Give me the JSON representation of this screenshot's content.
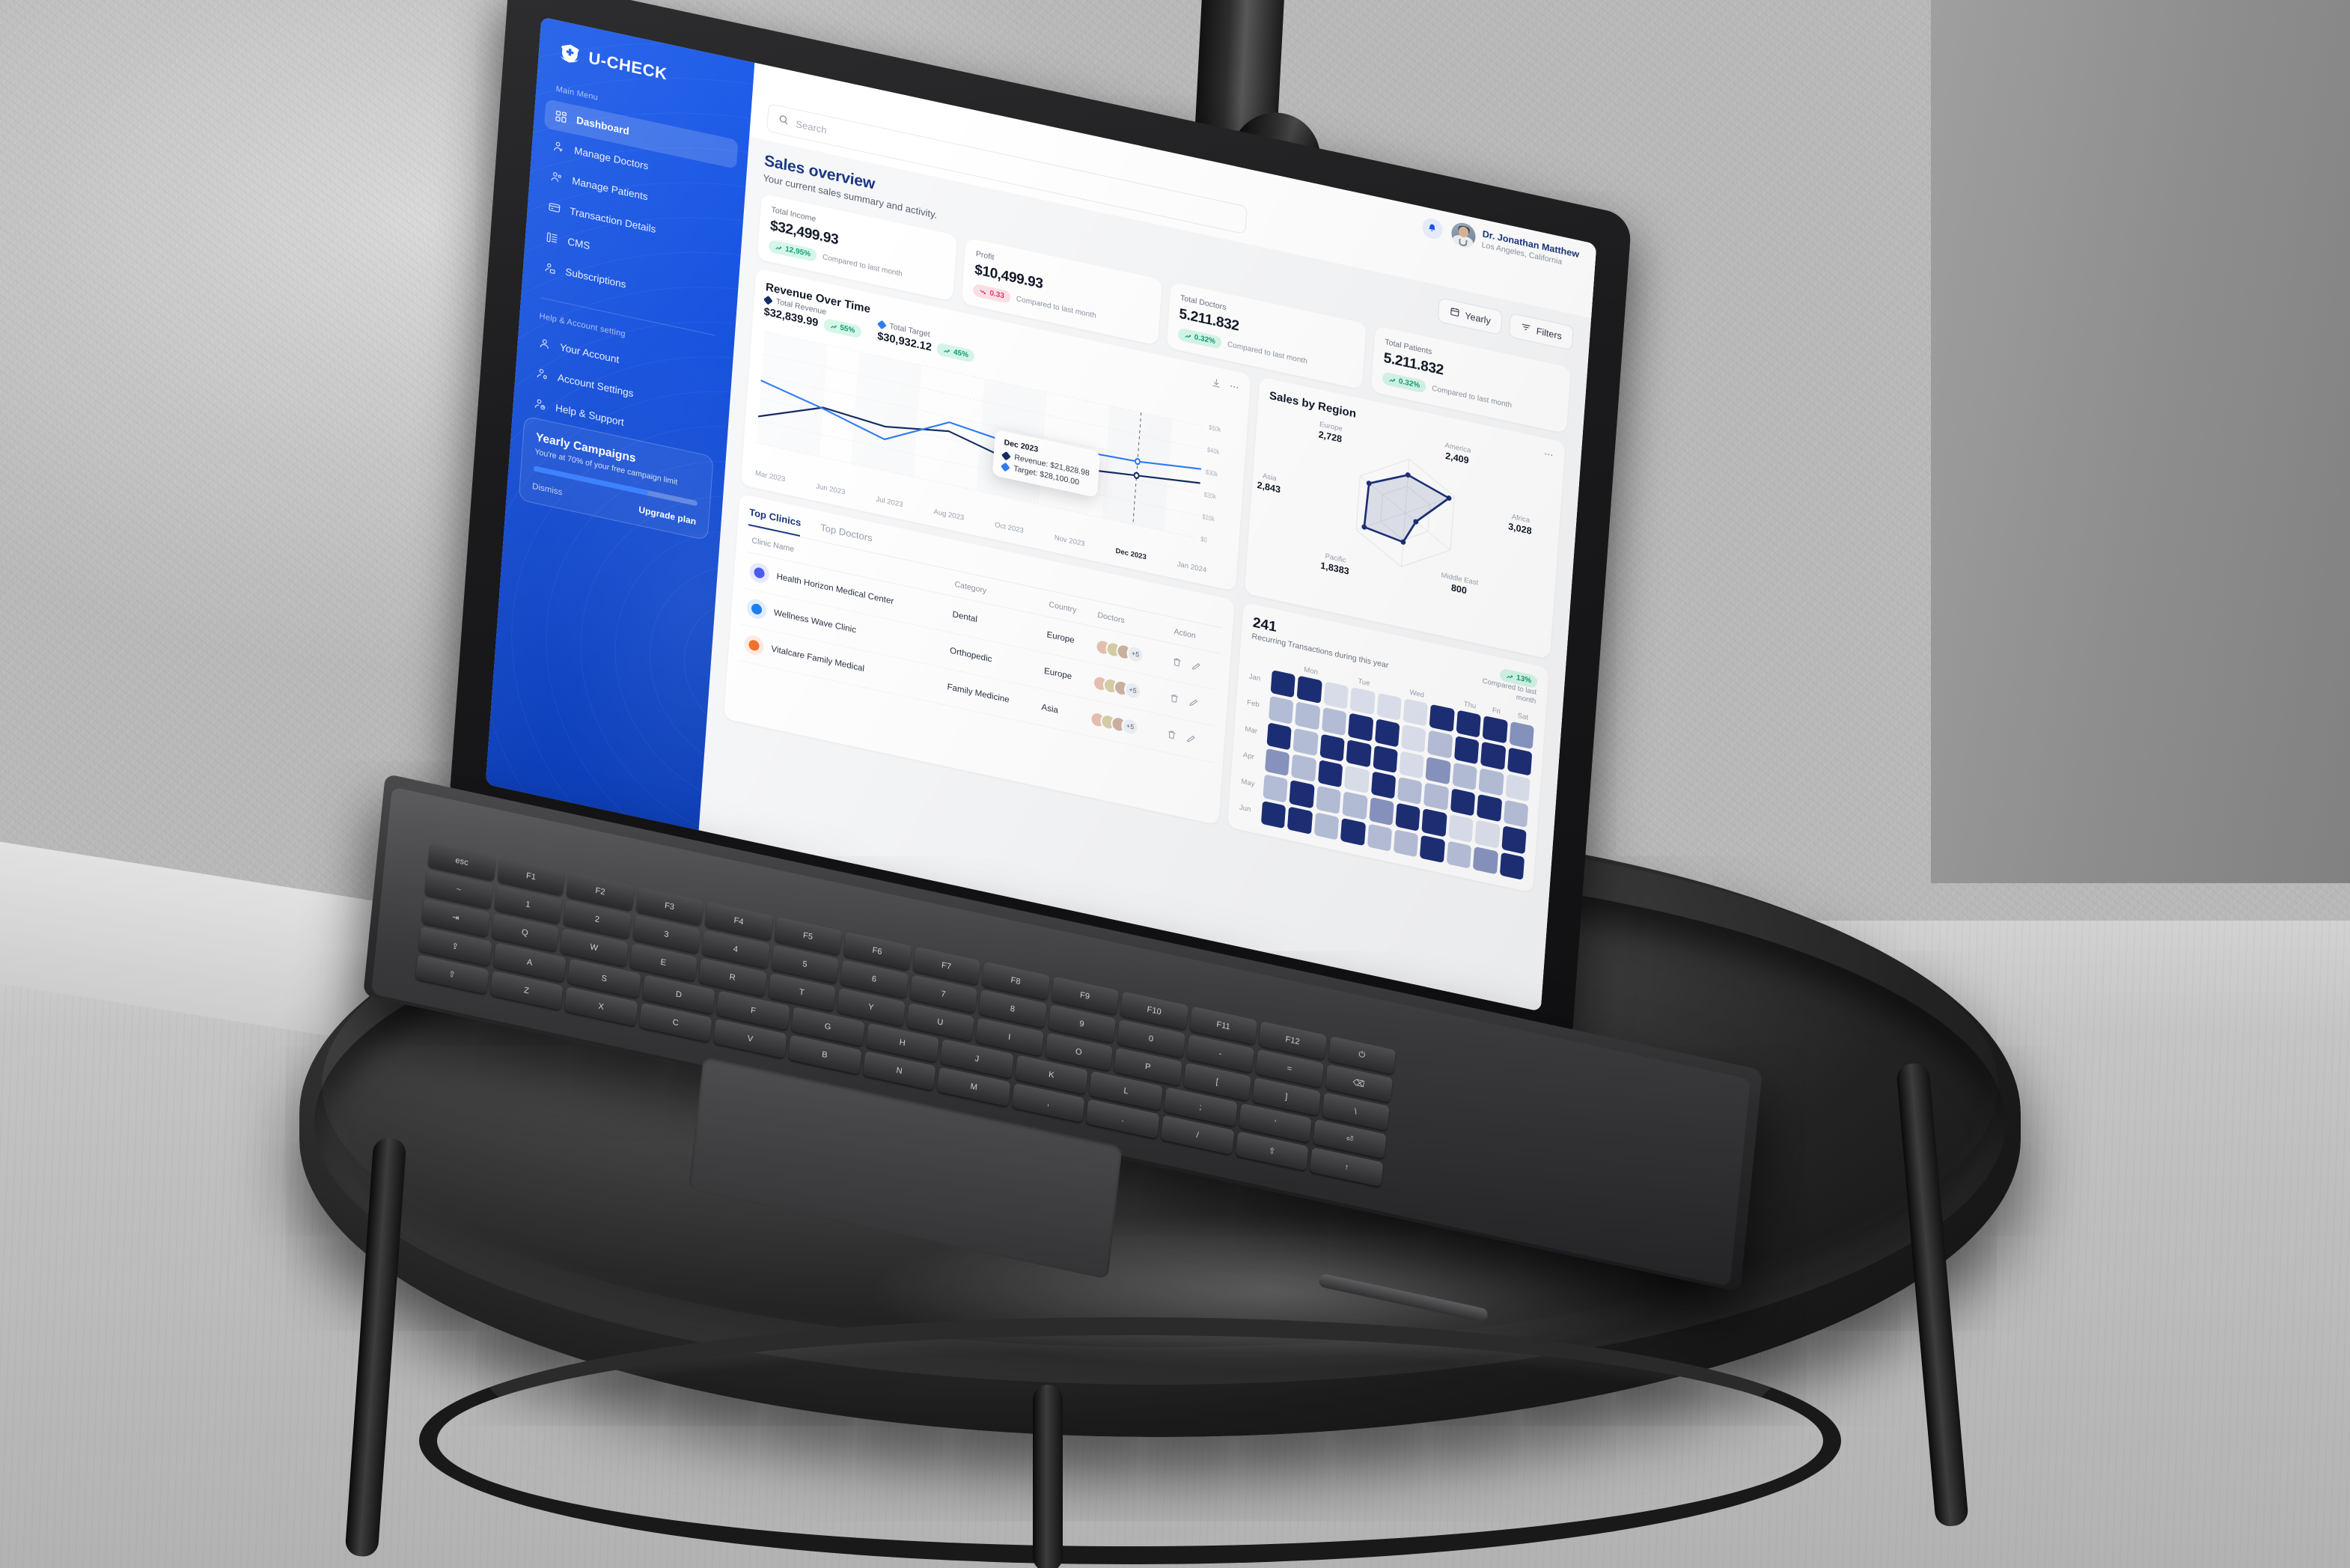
{
  "brand": {
    "name": "U-CHECK",
    "logo_icon": "shield-medical-icon"
  },
  "sidebar": {
    "main_label": "Main Menu",
    "items": [
      {
        "label": "Dashboard",
        "icon": "grid-icon",
        "active": true
      },
      {
        "label": "Manage Doctors",
        "icon": "user-doctor-icon",
        "active": false
      },
      {
        "label": "Manage Patients",
        "icon": "user-group-icon",
        "active": false
      },
      {
        "label": "Transaction Details",
        "icon": "card-icon",
        "active": false
      },
      {
        "label": "CMS",
        "icon": "list-icon",
        "active": false
      },
      {
        "label": "Subscriptions",
        "icon": "user-card-icon",
        "active": false
      }
    ],
    "help_label": "Help & Account setting",
    "help_items": [
      {
        "label": "Your Account",
        "icon": "user-icon"
      },
      {
        "label": "Account Settings",
        "icon": "user-gear-icon"
      },
      {
        "label": "Help & Support",
        "icon": "user-help-icon"
      }
    ],
    "promo": {
      "title": "Yearly Campaigns",
      "subtitle": "You're at 70% of your free campaign limit",
      "progress": 70,
      "dismiss_label": "Dismiss",
      "upgrade_label": "Upgrade plan"
    }
  },
  "topbar": {
    "notification_icon": "bell-icon",
    "user_name": "Dr. Jonathan Matthew",
    "user_location": "Los Angeles, California",
    "search_placeholder": "Search",
    "search_value": "",
    "search_icon": "search-icon"
  },
  "page": {
    "title": "Sales overview",
    "subtitle": "Your current sales summary and activity.",
    "actions": [
      {
        "label": "Yearly",
        "icon": "calendar-icon"
      },
      {
        "label": "Filters",
        "icon": "filter-icon"
      }
    ]
  },
  "stats": [
    {
      "label": "Total Income",
      "value": "$32,499.93",
      "delta": "12,95%",
      "dir": "up",
      "compare": "Compared to last month"
    },
    {
      "label": "Profit",
      "value": "$10,499.93",
      "delta": "0.33",
      "dir": "down",
      "compare": "Compared to last month"
    },
    {
      "label": "Total Doctors",
      "value": "5.211.832",
      "delta": "0.32%",
      "dir": "up",
      "compare": "Compared to last month"
    },
    {
      "label": "Total Patients",
      "value": "5.211.832",
      "delta": "0.32%",
      "dir": "up",
      "compare": "Compared to last month"
    }
  ],
  "revenue_card": {
    "title": "Revenue Over Time",
    "download_icon": "download-icon",
    "more_icon": "more-horizontal-icon",
    "legend": [
      {
        "name": "Total Revenue",
        "value": "$32,839.99",
        "delta": "55%",
        "color": "#132a63"
      },
      {
        "name": "Total Target",
        "value": "$30,932.12",
        "delta": "45%",
        "color": "#2f7bf6"
      }
    ],
    "tooltip": {
      "title": "Dec 2023",
      "rows": [
        {
          "label": "Revenue: $21,828.98",
          "color": "#132a63"
        },
        {
          "label": "Target: $28,100.00",
          "color": "#2f7bf6"
        }
      ]
    }
  },
  "region_card": {
    "title": "Sales by Region",
    "more_icon": "more-horizontal-icon"
  },
  "heatmap_card": {
    "value": "241",
    "subtitle": "Recurring Transactions during this year",
    "delta": "13%",
    "dir": "up",
    "compare": "Compared to last month"
  },
  "table": {
    "tabs": [
      {
        "label": "Top Clinics",
        "active": true
      },
      {
        "label": "Top Doctors",
        "active": false
      }
    ],
    "columns": [
      "Clinic Name",
      "Category",
      "Country",
      "Doctors",
      "Action"
    ],
    "rows": [
      {
        "name": "Health Horizon Medical Center",
        "category": "Dental",
        "country": "Europe",
        "doctors_more": "+5",
        "logo": "#4a5cf0"
      },
      {
        "name": "Wellness Wave Clinic",
        "category": "Orthopedic",
        "country": "Europe",
        "doctors_more": "+5",
        "logo": "#1e7ef0"
      },
      {
        "name": "Vitalcare Family Medical",
        "category": "Family Medicine",
        "country": "Asia",
        "doctors_more": "+5",
        "logo": "#f2722b"
      }
    ],
    "delete_icon": "trash-icon",
    "edit_icon": "pencil-icon"
  },
  "colors": {
    "brand_blue": "#1556e8",
    "deep_navy": "#17347f",
    "revenue_line": "#132a63",
    "target_line": "#2f7bf6",
    "up_green": "#0e9f6e",
    "down_red": "#e0366b"
  },
  "chart_data": [
    {
      "type": "line",
      "title": "Revenue Over Time",
      "xlabel": "",
      "ylabel": "",
      "ylim": [
        0,
        50000
      ],
      "yticks": [
        "$0",
        "$10k",
        "$20k",
        "$30k",
        "$40k",
        "$50k"
      ],
      "x": [
        "Mar 2023",
        "Jun 2023",
        "Jul 2023",
        "Aug 2023",
        "Oct 2023",
        "Nov 2023",
        "Dec 2023",
        "Jan 2024"
      ],
      "grid": true,
      "legend": "top-left",
      "highlight_x": "Dec 2023",
      "series": [
        {
          "name": "Total Revenue",
          "color": "#132a63",
          "values": [
            12000,
            22000,
            19500,
            23500,
            16500,
            19200,
            21829,
            24500
          ]
        },
        {
          "name": "Total Target",
          "color": "#2f7bf6",
          "values": [
            28000,
            21500,
            13800,
            27500,
            24000,
            27200,
            28100,
            30800
          ]
        }
      ]
    },
    {
      "type": "radar",
      "title": "Sales by Region",
      "categories": [
        "America",
        "Africa",
        "Middle East",
        "Pacific",
        "Asia",
        "Europe"
      ],
      "values": [
        2409,
        3028,
        800,
        18383,
        2843,
        2728
      ],
      "value_labels": [
        "2,409",
        "3,028",
        "800",
        "1,8383",
        "2,843",
        "2,728"
      ],
      "grid": true,
      "legend": "none"
    },
    {
      "type": "heatmap",
      "title": "Recurring Transactions during this year",
      "total": 241,
      "xlabel": "",
      "ylabel": "",
      "columns": [
        "",
        "Mon",
        "",
        "Tue",
        "",
        "Wed",
        "",
        "Thu",
        "Fri",
        "Sat"
      ],
      "rows": [
        "Jan",
        "Feb",
        "Mar",
        "Apr",
        "May",
        "Jun"
      ],
      "values": [
        [
          4,
          4,
          1,
          1,
          1,
          1,
          4,
          4,
          4,
          3
        ],
        [
          2,
          2,
          2,
          4,
          4,
          1,
          2,
          4,
          4,
          4
        ],
        [
          4,
          2,
          4,
          4,
          4,
          1,
          3,
          2,
          2,
          1
        ],
        [
          3,
          2,
          4,
          1,
          4,
          2,
          2,
          4,
          4,
          2
        ],
        [
          2,
          4,
          2,
          2,
          3,
          4,
          4,
          1,
          1,
          4
        ],
        [
          4,
          4,
          2,
          4,
          2,
          2,
          4,
          2,
          3,
          4
        ]
      ],
      "scale": [
        "#dfe4f0",
        "#b9c2dc",
        "#8a97c3",
        "#1d2f77"
      ]
    }
  ]
}
